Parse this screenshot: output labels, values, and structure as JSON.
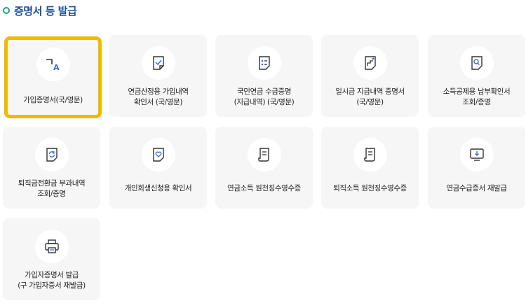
{
  "section": {
    "title": "증명서 등 발급"
  },
  "cards": [
    {
      "label": "가입증명서(국/영문)",
      "icon": "translate-icon",
      "selected": true
    },
    {
      "label": "연금산정용 가입내역\n확인서 (국/영문)",
      "icon": "document-check-icon"
    },
    {
      "label": "국민연금 수급증명\n(지급내역) (국/영문)",
      "icon": "document-list-icon"
    },
    {
      "label": "일시금 지급내역 증명서\n(국/영문)",
      "icon": "document-chart-icon"
    },
    {
      "label": "소득공제용 납부확인서\n조회/증명",
      "icon": "document-search-icon"
    },
    {
      "label": "퇴직금전환금 부과내역\n조회/증명",
      "icon": "document-refresh-icon"
    },
    {
      "label": "개인회생신청용 확인서",
      "icon": "document-heart-icon"
    },
    {
      "label": "연금소득 원천징수영수증",
      "icon": "receipt-icon"
    },
    {
      "label": "퇴직소득 원천징수영수증",
      "icon": "receipt-icon"
    },
    {
      "label": "연금수급증서 재발급",
      "icon": "monitor-download-icon"
    },
    {
      "label": "가입자증명서 발급\n(구 가입자증서 재발급)",
      "icon": "printer-icon"
    }
  ],
  "colors": {
    "selected_border": "#f2b900",
    "title": "#1d4f9a",
    "bullet": "#1fa37a",
    "icon_accent": "#3a6fd8"
  }
}
